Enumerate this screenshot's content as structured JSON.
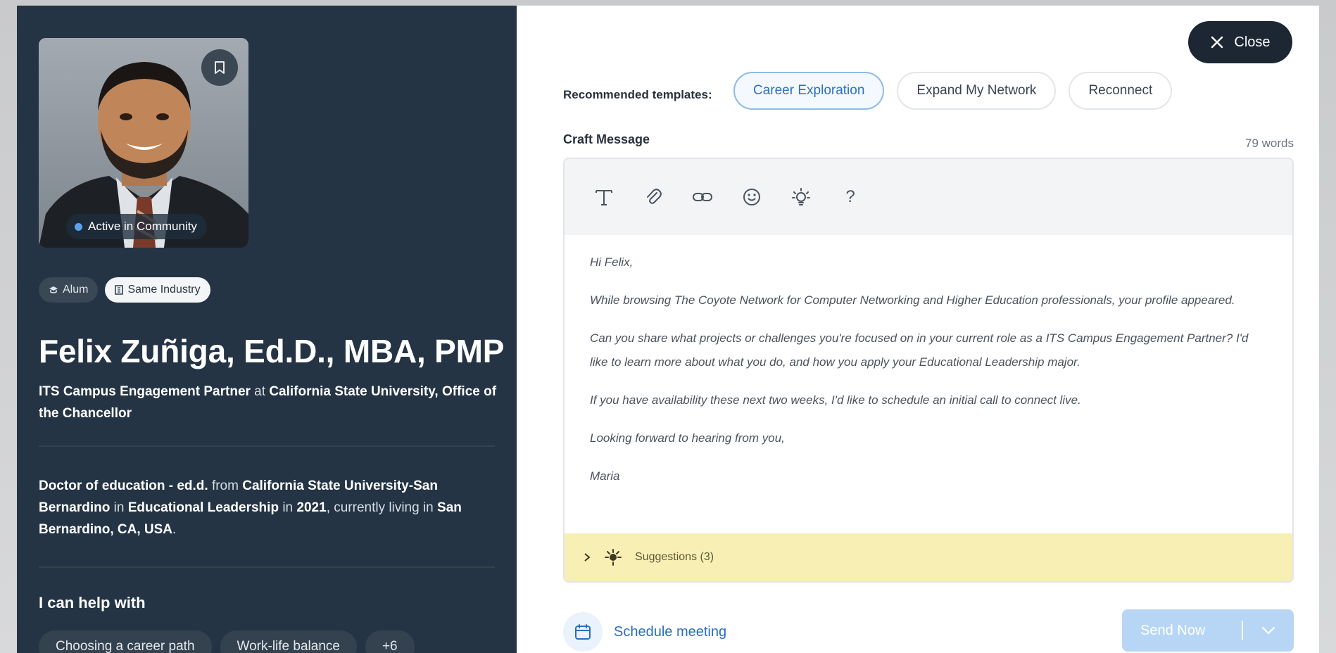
{
  "profile": {
    "active_badge": "Active in Community",
    "tags": [
      "Alum",
      "Same Industry"
    ],
    "name": "Felix Zuñiga, Ed.D., MBA, PMP",
    "role_title": "ITS Campus Engagement Partner",
    "role_at": " at ",
    "role_org": "California State University, Office of the Chancellor",
    "edu_degree": "Doctor of education - ed.d.",
    "edu_from": " from ",
    "edu_school": "California State University-San Bernardino",
    "edu_in": " in ",
    "edu_major": "Educational Leadership",
    "edu_in2": " in ",
    "edu_year": "2021",
    "edu_living": ", currently living in ",
    "edu_location": "San Bernardino, CA, USA",
    "edu_end": ".",
    "help_title": "I can help with",
    "help_tags": [
      "Choosing a career path",
      "Work-life balance",
      "+6"
    ]
  },
  "composer": {
    "close_label": "Close",
    "templates_label": "Recommended templates:",
    "templates": [
      "Career Exploration",
      "Expand My Network",
      "Reconnect"
    ],
    "craft_label": "Craft Message",
    "word_count": "79 words",
    "message": [
      "Hi Felix,",
      "While browsing The Coyote Network for Computer Networking and Higher Education professionals, your profile appeared.",
      "Can you share what projects or challenges you're focused on in your current role as a ITS Campus Engagement Partner? I'd like to learn more about what you do, and how you apply your Educational Leadership major.",
      "If you have availability these next two weeks, I'd like to schedule an initial call to connect live.",
      "Looking forward to hearing from you,",
      "Maria"
    ],
    "toolbar_icons": [
      "text-format-icon",
      "attachment-icon",
      "link-icon",
      "emoji-icon",
      "lightbulb-icon",
      "help-icon"
    ],
    "suggestions_label": "Suggestions (3)",
    "schedule_label": "Schedule meeting",
    "send_label": "Send Now"
  },
  "colors": {
    "left_panel": "#243444",
    "accent": "#2d6fc0",
    "send_disabled": "#b7d6f6",
    "suggestions_bg": "#f8efb4"
  }
}
